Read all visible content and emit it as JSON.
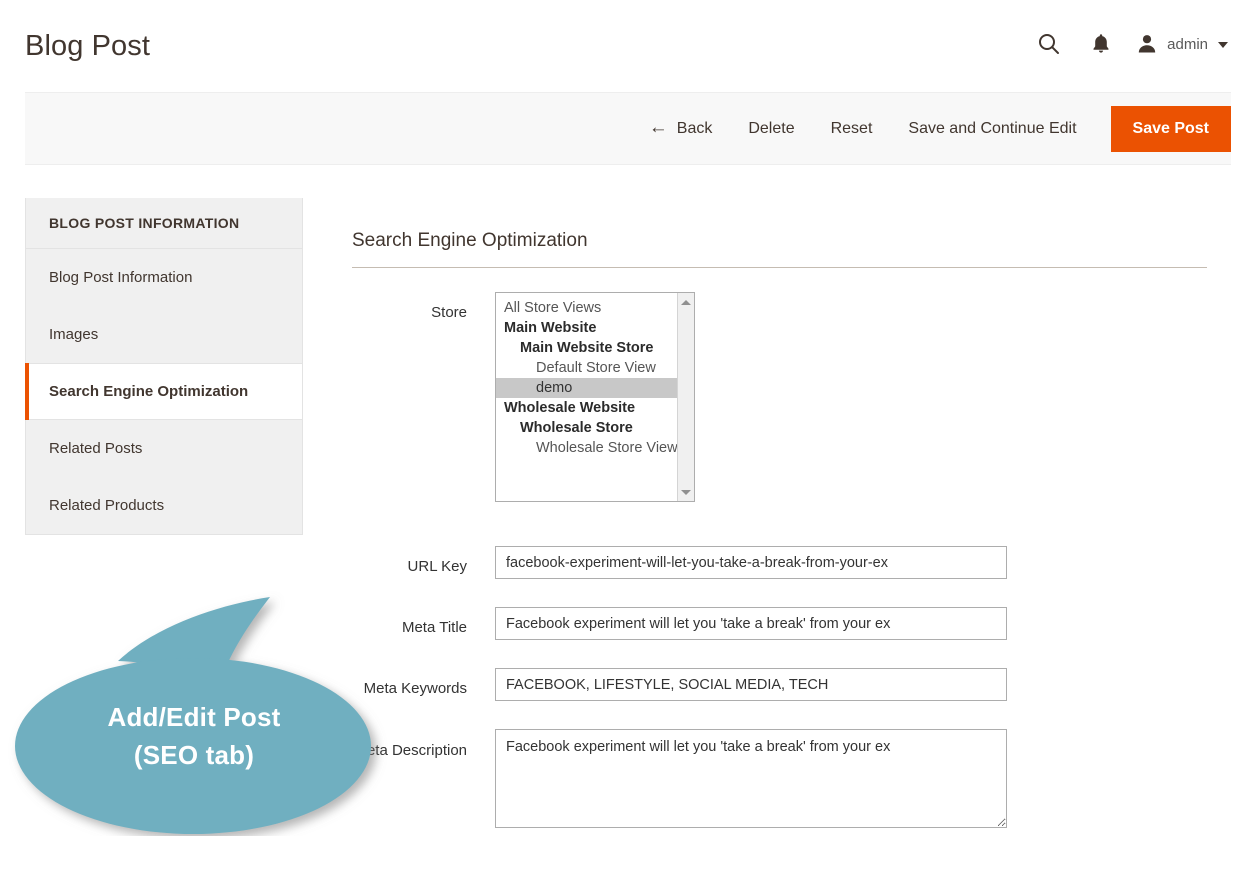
{
  "header": {
    "title": "Blog Post",
    "search_icon": "search-icon",
    "notifications_icon": "bell-icon",
    "user_icon": "user-avatar-icon",
    "admin_label": "admin",
    "caret_icon": "chevron-down-icon"
  },
  "toolbar": {
    "back_arrow": "←",
    "back_label": "Back",
    "delete_label": "Delete",
    "reset_label": "Reset",
    "save_continue_label": "Save and Continue Edit",
    "save_label": "Save Post",
    "primary_color": "#eb5202",
    "background_color": "#f8f8f8"
  },
  "sidebar": {
    "heading": "BLOG POST INFORMATION",
    "active_accent_color": "#eb5202",
    "items": [
      {
        "label": "Blog Post Information",
        "active": false
      },
      {
        "label": "Images",
        "active": false
      },
      {
        "label": "Search Engine Optimization",
        "active": true
      },
      {
        "label": "Related Posts",
        "active": false
      },
      {
        "label": "Related Products",
        "active": false
      }
    ]
  },
  "main": {
    "section_title": "Search Engine Optimization",
    "store": {
      "label": "Store",
      "options": [
        {
          "text": "All Store Views",
          "level": 0,
          "selected": false
        },
        {
          "text": "Main Website",
          "level": 1,
          "selected": false
        },
        {
          "text": "Main Website Store",
          "level": 2,
          "selected": false
        },
        {
          "text": "Default Store View",
          "level": 3,
          "selected": false
        },
        {
          "text": "demo",
          "level": 3,
          "selected": true
        },
        {
          "text": "Wholesale Website",
          "level": 1,
          "selected": false
        },
        {
          "text": "Wholesale Store",
          "level": 2,
          "selected": false
        },
        {
          "text": "Wholesale Store View",
          "level": 3,
          "selected": false
        }
      ],
      "selected_value": "demo",
      "selected_bg_color": "#c8c8c8",
      "scroll_up_icon": "triangle-up-icon",
      "scroll_down_icon": "triangle-down-icon"
    },
    "url_key": {
      "label": "URL Key",
      "value": "facebook-experiment-will-let-you-take-a-break-from-your-ex",
      "placeholder": ""
    },
    "meta_title": {
      "label": "Meta Title",
      "value": "Facebook experiment will let you 'take a break' from your ex",
      "placeholder": ""
    },
    "meta_keywords": {
      "label": "Meta Keywords",
      "value": "FACEBOOK, LIFESTYLE, SOCIAL MEDIA, TECH",
      "placeholder": ""
    },
    "meta_description": {
      "label": "Meta Description",
      "value": "Facebook experiment will let you 'take a break' from your ex",
      "placeholder": ""
    }
  },
  "callout": {
    "line1": "Add/Edit Post",
    "line2": "(SEO tab)",
    "fill_color": "#6fafc0"
  }
}
